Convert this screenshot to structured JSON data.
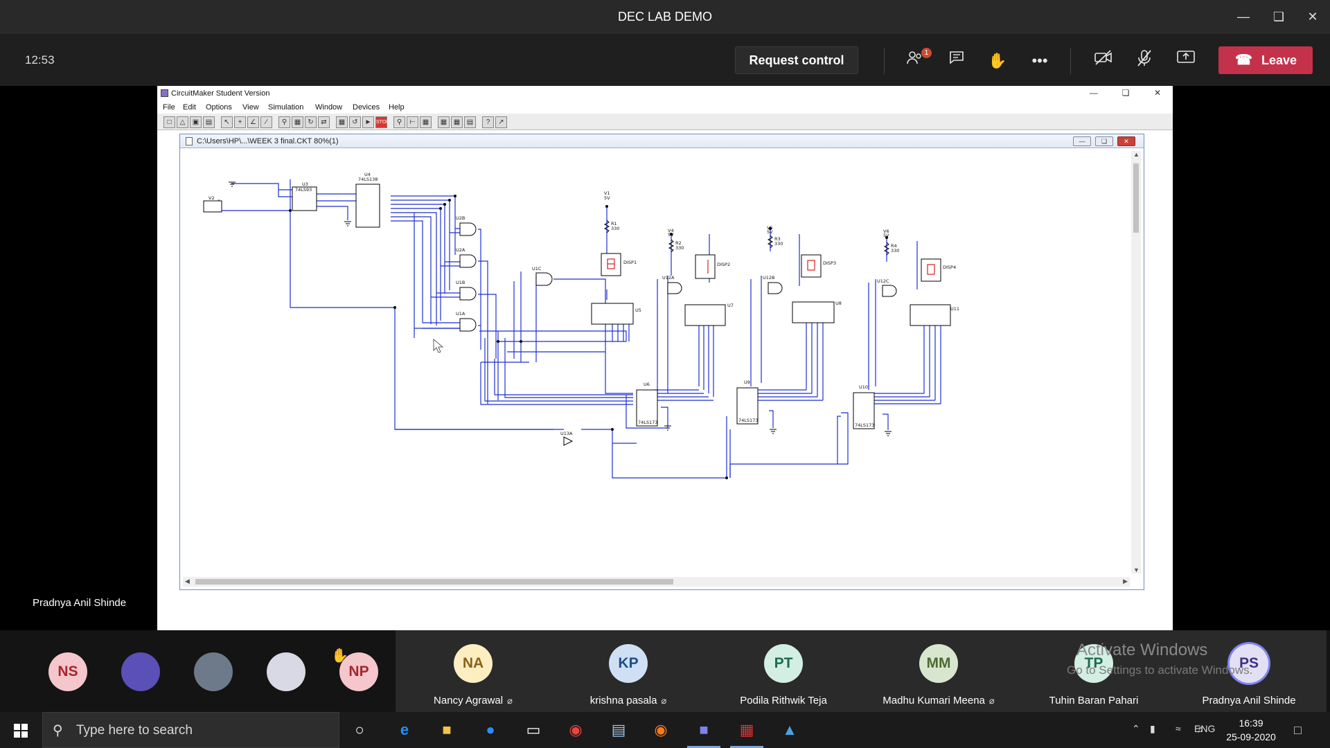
{
  "window": {
    "title": "DEC LAB DEMO"
  },
  "meeting": {
    "time": "12:53",
    "request_control_label": "Request control",
    "leave_label": "Leave",
    "participants_badge": "1",
    "presenter_name": "Pradnya Anil Shinde"
  },
  "circuitmaker": {
    "title": "CircuitMaker Student Version",
    "menu": [
      "File",
      "Edit",
      "Options",
      "View",
      "Simulation",
      "Window",
      "Devices",
      "Help"
    ],
    "document_title": "C:\\Users\\HP\\...\\WEEK 3 final.CKT 80%(1)"
  },
  "schematic": {
    "labels": {
      "u3": "U3",
      "u3_type": "74LS93",
      "u4": "U4",
      "u4_type": "74LS138",
      "v2": "V2",
      "u2b": "U2B",
      "u2a": "U2A",
      "u1b": "U1B",
      "u1a": "U1A",
      "u1c": "U1C",
      "u12a": "U12A",
      "u12b": "U12B",
      "u12c": "U12C",
      "u13a": "U13A",
      "v1": "V1",
      "v4": "V4",
      "v5": "V5",
      "v6": "V6",
      "vlabel": "5V",
      "r1": "R1",
      "r2": "R2",
      "r3": "R3",
      "r4": "R4",
      "rval": "330",
      "disp1": "DISP1",
      "disp2": "DISP2",
      "disp3": "DISP3",
      "disp4": "DISP4",
      "u5": "U5",
      "u7": "U7",
      "u8": "U8",
      "u11": "U11",
      "u6": "U6",
      "u9": "U9",
      "u10": "U10",
      "u173": "74LS173"
    }
  },
  "participants": [
    {
      "initials": "NS",
      "color": "#f5c6cb",
      "text_color": "#a4262c"
    },
    {
      "initials": "",
      "kind": "photo",
      "color": "#5b4fb8"
    },
    {
      "initials": "",
      "kind": "photo",
      "color": "#6c7a89"
    },
    {
      "initials": "",
      "kind": "photo",
      "color": "#d9d9e6"
    },
    {
      "initials": "NP",
      "color": "#f5c6cb",
      "text_color": "#a4262c",
      "hand_raised": true
    }
  ],
  "named_tiles": [
    {
      "initials": "NA",
      "name": "Nancy Agrawal",
      "muted": true,
      "color": "#fdeec2",
      "text_color": "#8a6116"
    },
    {
      "initials": "KP",
      "name": "krishna pasala",
      "muted": true,
      "color": "#cfe0f5",
      "text_color": "#1f4e86"
    },
    {
      "initials": "PT",
      "name": "Podila Rithwik Teja",
      "muted": false,
      "color": "#d3efe4",
      "text_color": "#1e6b4c"
    },
    {
      "initials": "MM",
      "name": "Madhu Kumari Meena",
      "muted": true,
      "color": "#d9e6cf",
      "text_color": "#4a6a2f"
    },
    {
      "initials": "TP",
      "name": "Tuhin Baran Pahari",
      "muted": false,
      "color": "#d3efe4",
      "text_color": "#1e6b4c"
    },
    {
      "initials": "PS",
      "name": "Pradnya Anil Shinde",
      "muted": false,
      "color": "#e3e0f4",
      "text_color": "#3d3480"
    }
  ],
  "watermark": {
    "line1": "Activate Windows",
    "line2": "Go to Settings to activate Windows."
  },
  "taskbar": {
    "search_placeholder": "Type here to search",
    "lang": "ENG",
    "time": "16:39",
    "date": "25-09-2020"
  }
}
